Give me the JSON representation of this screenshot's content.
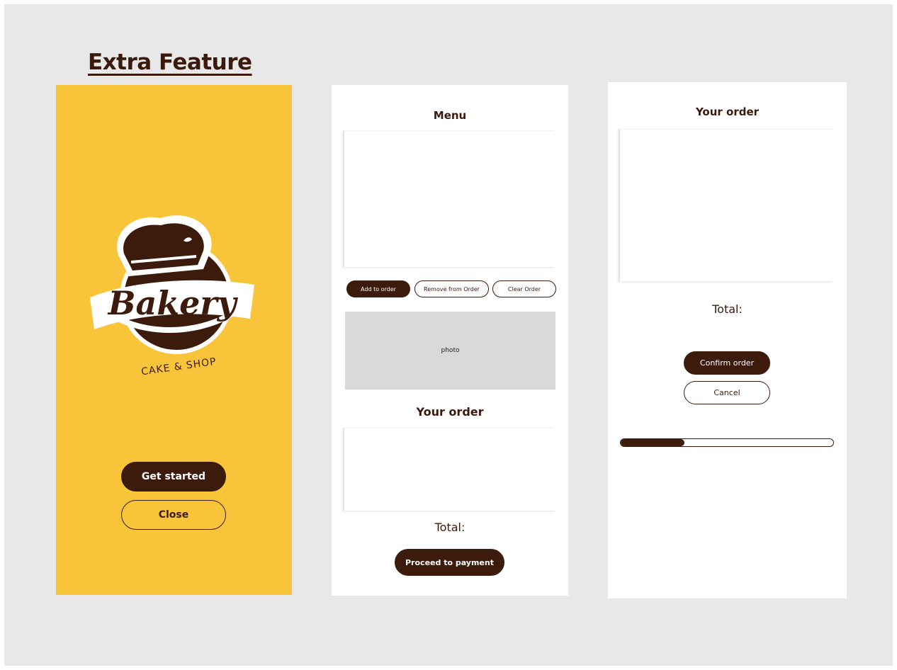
{
  "page": {
    "title": "Extra Feature"
  },
  "colors": {
    "brand_dark": "#3c1a0c",
    "brand_yellow": "#f8c53a",
    "photo_placeholder": "#d9d9d9"
  },
  "splash": {
    "logo_word": "Bakery",
    "logo_tagline": "CAKE & SHOP",
    "get_started_label": "Get started",
    "close_label": "Close"
  },
  "menu_screen": {
    "title": "Menu",
    "add_label": "Add to order",
    "remove_label": "Remove from Order",
    "clear_label": "Clear Order",
    "photo_label": "photo",
    "order_title": "Your order",
    "total_label": "Total:",
    "proceed_label": "Proceed to payment"
  },
  "order_screen": {
    "title": "Your order",
    "total_label": "Total:",
    "confirm_label": "Confirm order",
    "cancel_label": "Cancel",
    "progress": 0.3
  }
}
